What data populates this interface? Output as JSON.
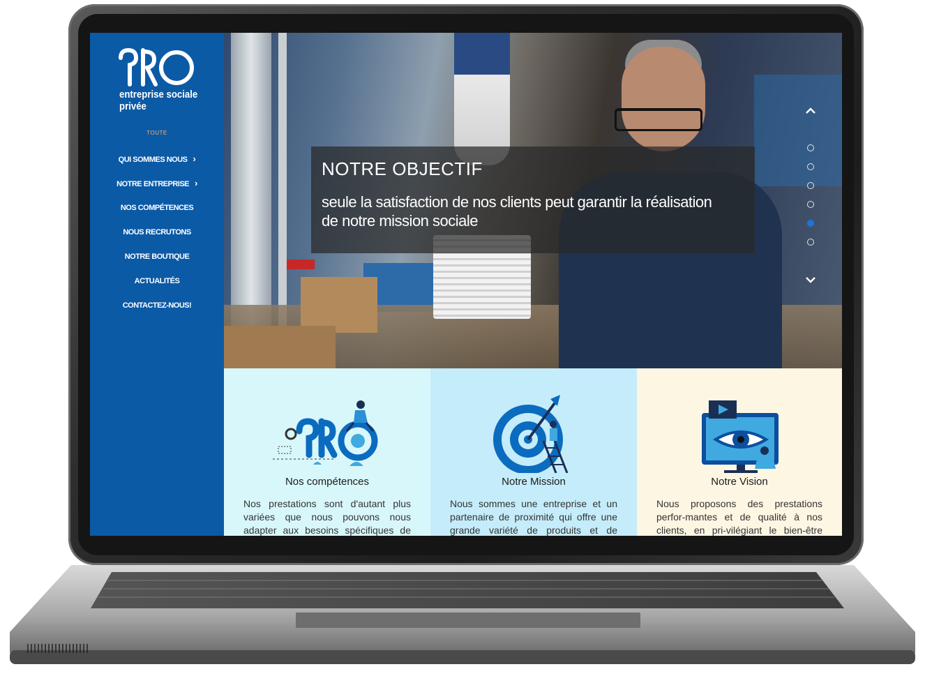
{
  "brand": {
    "logo_mark": "PRO",
    "line1": "entreprise sociale",
    "line2": "privée"
  },
  "sidebar": {
    "filter_label": "TOUTE",
    "items": [
      {
        "label": "QUI SOMMES NOUS",
        "has_chevron": true
      },
      {
        "label": "NOTRE ENTREPRISE",
        "has_chevron": true
      },
      {
        "label": "NOS COMPÉTENCES",
        "has_chevron": false
      },
      {
        "label": "NOUS RECRUTONS",
        "has_chevron": false
      },
      {
        "label": "NOTRE BOUTIQUE",
        "has_chevron": false
      },
      {
        "label": "ACTUALITÉS",
        "has_chevron": false
      },
      {
        "label": "CONTACTEZ-NOUS!",
        "has_chevron": false
      }
    ]
  },
  "hero": {
    "title": "NOTRE OBJECTIF",
    "subtitle": "seule la satisfaction de nos clients peut garantir la réalisation de notre mission sociale"
  },
  "slider": {
    "dots": 6,
    "active_index": 4,
    "up_icon": "chevron-up-icon",
    "down_icon": "chevron-down-icon"
  },
  "cards": [
    {
      "title": "Nos compétences",
      "text": "Nos prestations sont d'autant plus variées que nous pouvons nous adapter aux besoins spécifiques de",
      "icon": "pro-skills-illustration"
    },
    {
      "title": "Notre Mission",
      "text": "Nous sommes une entreprise et un partenaire de proximité qui offre une grande variété de produits et de",
      "icon": "target-illustration"
    },
    {
      "title": "Notre Vision",
      "text": "Nous proposons des prestations perfor-mantes et de qualité à nos clients, en pri-vilégiant le bien-être",
      "icon": "eye-monitor-illustration"
    }
  ],
  "colors": {
    "sidebar_bg": "#0b5aa6",
    "accent_orange": "#f5b26b",
    "card1_bg": "#d8f7fb",
    "card2_bg": "#c5ecfa",
    "card3_bg": "#fdf6e3",
    "dot_active": "#1877d9"
  }
}
